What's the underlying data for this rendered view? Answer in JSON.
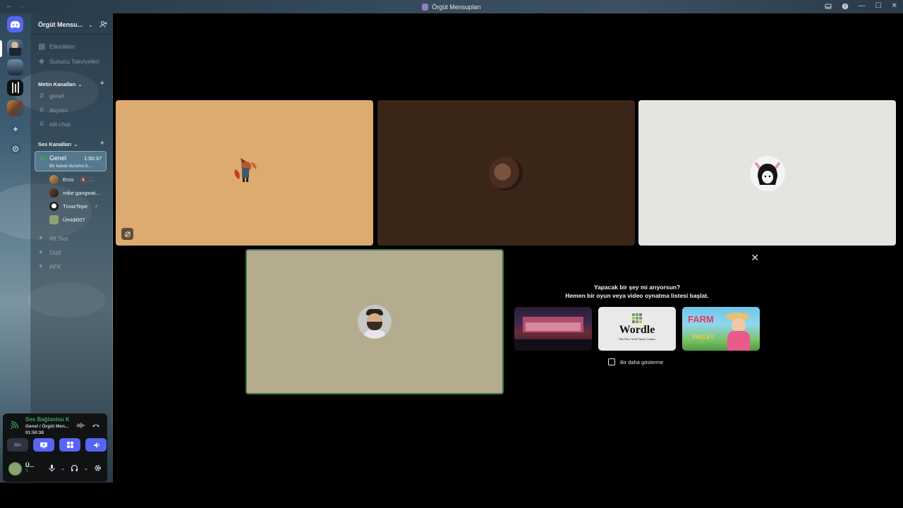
{
  "window": {
    "title": "Örgüt Mensupları"
  },
  "guild": {
    "name": "Örgüt Mensu..."
  },
  "nav_items": [
    {
      "label": "Etkinlikler"
    },
    {
      "label": "Sunucu Takviyeleri"
    }
  ],
  "text_category": {
    "label": "Metin Kanalları"
  },
  "text_channels": [
    {
      "label": "genel"
    },
    {
      "label": "duyuru"
    },
    {
      "label": "elit-chat"
    }
  ],
  "voice_category": {
    "label": "Ses Kanalları"
  },
  "active_voice": {
    "name": "Genel",
    "time": "1:50:37",
    "status": "Bir kanal durumu b..."
  },
  "voice_members": [
    {
      "name": "Erco",
      "flags": "🔇 🎧"
    },
    {
      "name": "mike gangwat...",
      "flags": ""
    },
    {
      "name": "TınazTepe",
      "flags": "⚡ "
    },
    {
      "name": "Ümidi007",
      "flags": ""
    }
  ],
  "other_voice": [
    {
      "label": "Alt Ses"
    },
    {
      "label": "Gizli"
    },
    {
      "label": "AFK"
    }
  ],
  "rtc": {
    "status": "Ses Bağlantısı K",
    "channel": "Genel / Örgüt Men...",
    "time": "01:50:38"
  },
  "me": {
    "name": "Ü...",
    "sub": "S"
  },
  "promo": {
    "line1": "Yapacak bir şey mi arıyorsun?",
    "line2": "Hemen bir oyun veya video oynatma listesi başlat.",
    "checkbox": "Bir daha gösterme",
    "wordle_title": "Wordle",
    "wordle_sub": "The New York Times Games",
    "farm_title": "FARM",
    "farm_sub": "VALLEY"
  },
  "colors": {
    "accent": "#5865f2",
    "online": "#3ba55c",
    "tile1": "#ddaa70",
    "tile2": "#3a2618",
    "tile3": "#e4e4e0",
    "tile4": "#b5ab8e"
  }
}
